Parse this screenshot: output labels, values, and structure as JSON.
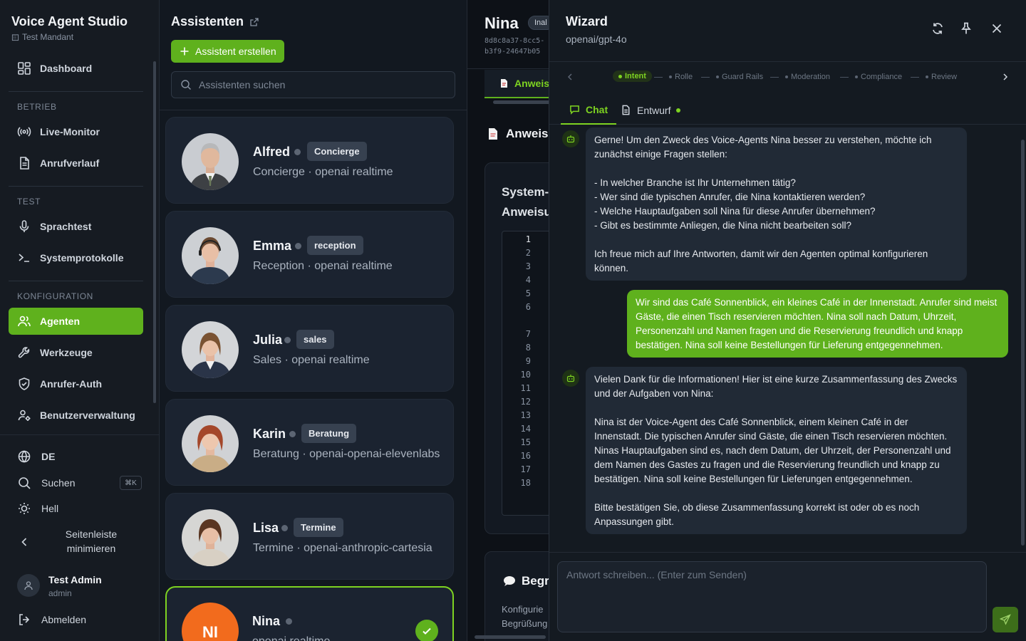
{
  "sidebar": {
    "brand_title": "Voice Agent Studio",
    "brand_sub": "Test Mandant",
    "dashboard": "Dashboard",
    "section_betrieb": "BETRIEB",
    "live_monitor": "Live-Monitor",
    "anrufverlauf": "Anrufverlauf",
    "section_test": "TEST",
    "sprachtest": "Sprachtest",
    "systemprotokolle": "Systemprotokolle",
    "section_konfiguration": "KONFIGURATION",
    "agenten": "Agenten",
    "werkzeuge": "Werkzeuge",
    "anrufer_auth": "Anrufer-Auth",
    "benutzerverwaltung": "Benutzerverwaltung",
    "language": "DE",
    "suchen": "Suchen",
    "shortcut": "⌘K",
    "theme": "Hell",
    "collapse": "Seitenleiste minimieren",
    "user_name": "Test Admin",
    "user_role": "admin",
    "logout": "Abmelden"
  },
  "list": {
    "title": "Assistenten",
    "create_label": "Assistent erstellen",
    "search_placeholder": "Assistenten suchen",
    "assistants": [
      {
        "name": "Alfred",
        "badge": "Concierge",
        "sub": "Concierge · openai realtime"
      },
      {
        "name": "Emma",
        "badge": "reception",
        "sub": "Reception · openai realtime"
      },
      {
        "name": "Julia",
        "badge": "sales",
        "sub": "Sales · openai realtime"
      },
      {
        "name": "Karin",
        "badge": "Beratung",
        "sub": "Beratung · openai-openai-elevenlabs"
      },
      {
        "name": "Lisa",
        "badge": "Termine",
        "sub": "Termine · openai-anthropic-cartesia"
      },
      {
        "name": "Nina",
        "initials": "NI",
        "sub": "openai realtime"
      }
    ]
  },
  "detail": {
    "name": "Nina",
    "status_pill": "Inal",
    "hash_line1": "8d8c8a37-8cc5-",
    "hash_line2": "b3f9-24647b05",
    "tab_label": "Anweis",
    "section_heading": "Anweis",
    "system_line1": "System-",
    "system_line2": "Anweisu",
    "line_numbers": [
      "1",
      "2",
      "3",
      "4",
      "5",
      "6",
      "7",
      "8",
      "9",
      "10",
      "11",
      "12",
      "13",
      "14",
      "15",
      "16",
      "17",
      "18"
    ],
    "card2_title": "Begr",
    "card2_line1": "Konfigurie",
    "card2_line2": "Begrüßung"
  },
  "wizard": {
    "title": "Wizard",
    "model": "openai/gpt-4o",
    "steps": [
      "Intent",
      "Rolle",
      "Guard Rails",
      "Moderation",
      "Compliance",
      "Review"
    ],
    "tab_chat": "Chat",
    "tab_draft": "Entwurf",
    "messages": [
      {
        "role": "bot",
        "text": "Gerne! Um den Zweck des Voice-Agents Nina besser zu verstehen, möchte ich zunächst einige Fragen stellen:\n\n- In welcher Branche ist Ihr Unternehmen tätig?\n- Wer sind die typischen Anrufer, die Nina kontaktieren werden?\n- Welche Hauptaufgaben soll Nina für diese Anrufer übernehmen?\n- Gibt es bestimmte Anliegen, die Nina nicht bearbeiten soll?\n\nIch freue mich auf Ihre Antworten, damit wir den Agenten optimal konfigurieren können."
      },
      {
        "role": "user",
        "text": "Wir sind das Café Sonnenblick, ein kleines Café in der Innenstadt. Anrufer sind meist Gäste, die einen Tisch reservieren möchten. Nina soll nach Datum, Uhrzeit, Personenzahl und Namen fragen und die Reservierung freundlich und knapp bestätigen. Nina soll keine Bestellungen für Lieferung entgegennehmen."
      },
      {
        "role": "bot",
        "text": "Vielen Dank für die Informationen! Hier ist eine kurze Zusammenfassung des Zwecks und der Aufgaben von Nina:\n\nNina ist der Voice-Agent des Café Sonnenblick, einem kleinen Café in der Innenstadt. Die typischen Anrufer sind Gäste, die einen Tisch reservieren möchten. Ninas Hauptaufgaben sind es, nach dem Datum, der Uhrzeit, der Personenzahl und dem Namen des Gastes zu fragen und die Reservierung freundlich und knapp zu bestätigen. Nina soll keine Bestellungen für Lieferungen entgegennehmen.\n\nBitte bestätigen Sie, ob diese Zusammenfassung korrekt ist oder ob es noch Anpassungen gibt."
      }
    ],
    "composer_placeholder": "Antwort schreiben... (Enter zum Senden)"
  },
  "colors": {
    "accent": "#5fb11d",
    "accent_light": "#7ed321",
    "bg": "#0f1318"
  }
}
